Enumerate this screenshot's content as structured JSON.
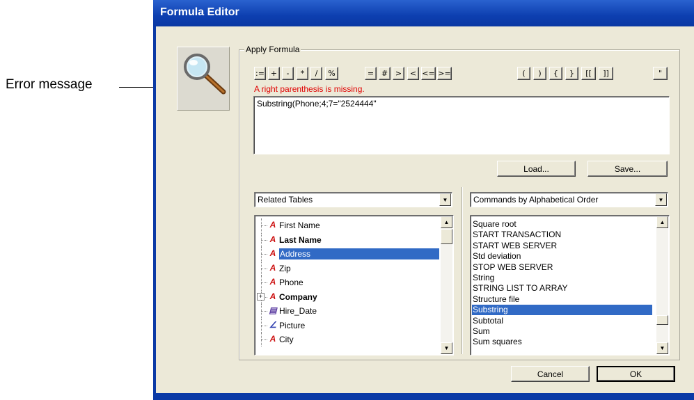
{
  "callout": {
    "label": "Error message"
  },
  "window": {
    "title": "Formula Editor"
  },
  "apply_group": {
    "legend": "Apply Formula"
  },
  "operators_group1": [
    ":=",
    "+",
    "-",
    "*",
    "/",
    "%"
  ],
  "operators_group2": [
    "=",
    "#",
    ">",
    "<",
    "<=",
    ">="
  ],
  "operators_group3": [
    "(",
    ")",
    "{",
    "}",
    "[[",
    "]]"
  ],
  "quote_button": "\"",
  "error_message": "A right parenthesis is missing.",
  "formula": {
    "value": "Substring(Phone;4;7=\"2524444\""
  },
  "buttons": {
    "load": "Load...",
    "save": "Save...",
    "cancel": "Cancel",
    "ok": "OK"
  },
  "left_combo": {
    "selected": "Related Tables"
  },
  "right_combo": {
    "selected": "Commands by Alphabetical Order"
  },
  "fields": [
    {
      "label": "First Name",
      "icon": "text-field-icon",
      "bold": false,
      "selected": false,
      "expandable": false
    },
    {
      "label": "Last Name",
      "icon": "text-field-icon",
      "bold": true,
      "selected": false,
      "expandable": false
    },
    {
      "label": "Address",
      "icon": "text-field-icon",
      "bold": false,
      "selected": true,
      "expandable": false
    },
    {
      "label": "Zip",
      "icon": "text-field-icon",
      "bold": false,
      "selected": false,
      "expandable": false
    },
    {
      "label": "Phone",
      "icon": "text-field-icon",
      "bold": false,
      "selected": false,
      "expandable": false
    },
    {
      "label": "Company",
      "icon": "text-field-icon",
      "bold": true,
      "selected": false,
      "expandable": true
    },
    {
      "label": "Hire_Date",
      "icon": "date-field-icon",
      "bold": false,
      "selected": false,
      "expandable": false
    },
    {
      "label": "Picture",
      "icon": "picture-field-icon",
      "bold": false,
      "selected": false,
      "expandable": false
    },
    {
      "label": "City",
      "icon": "text-field-icon",
      "bold": false,
      "selected": false,
      "expandable": false
    }
  ],
  "commands": [
    {
      "label": "Square root",
      "selected": false
    },
    {
      "label": "START TRANSACTION",
      "selected": false
    },
    {
      "label": "START WEB SERVER",
      "selected": false
    },
    {
      "label": "Std deviation",
      "selected": false
    },
    {
      "label": "STOP WEB SERVER",
      "selected": false
    },
    {
      "label": "String",
      "selected": false
    },
    {
      "label": "STRING LIST TO ARRAY",
      "selected": false
    },
    {
      "label": "Structure file",
      "selected": false
    },
    {
      "label": "Substring",
      "selected": true
    },
    {
      "label": "Subtotal",
      "selected": false
    },
    {
      "label": "Sum",
      "selected": false
    },
    {
      "label": "Sum squares",
      "selected": false
    }
  ],
  "colors": {
    "error": "#e00000",
    "selection": "#316ac5",
    "titlebar": "#0d3fb0",
    "dialog": "#ece9d8"
  }
}
